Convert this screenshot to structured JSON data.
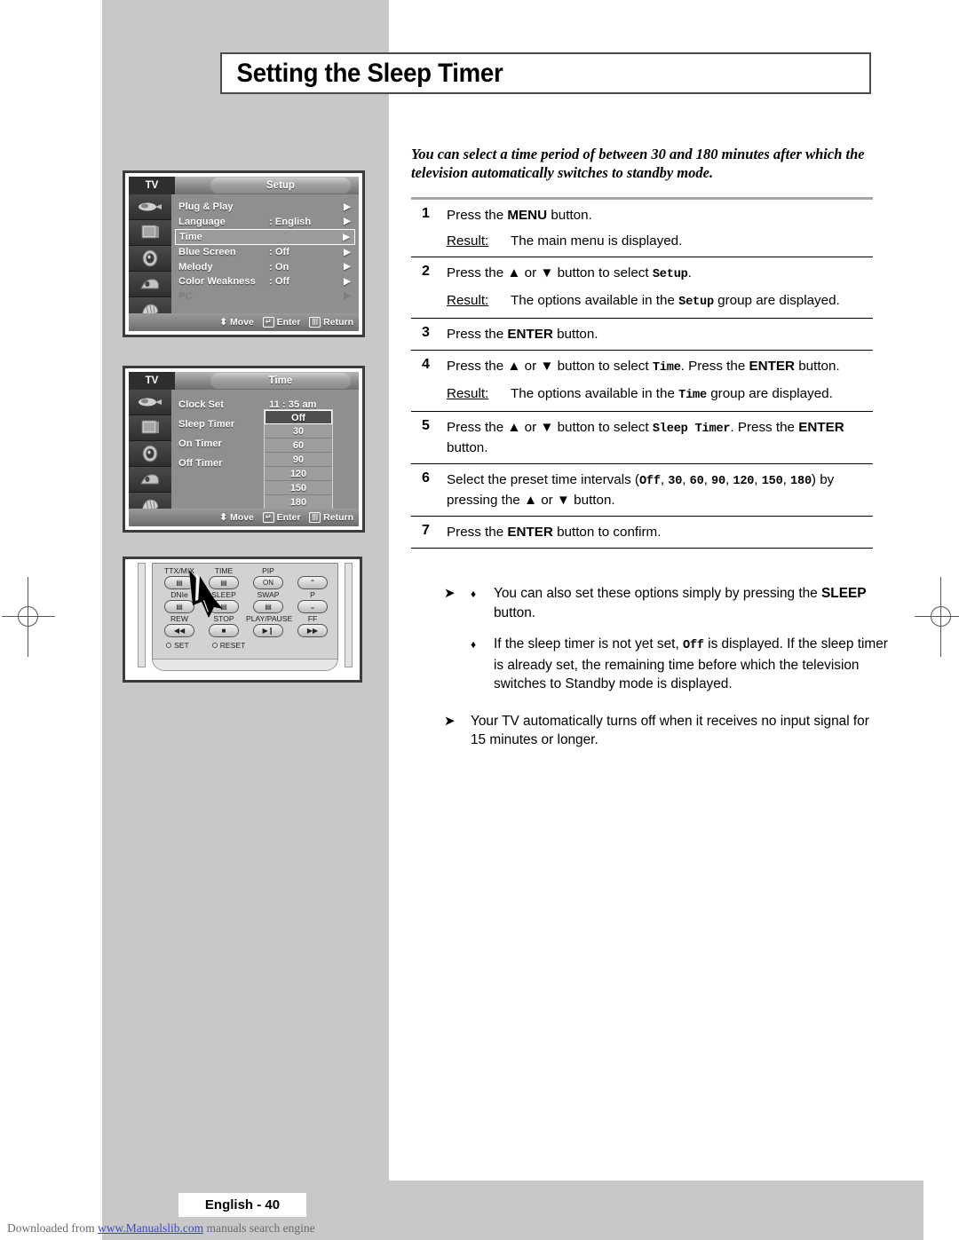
{
  "page": {
    "title": "Setting the Sleep Timer",
    "intro": "You can select a time period of between 30 and 180 minutes after which the television automatically switches to standby mode.",
    "footer_page_label": "English - 40",
    "download_prefix": "Downloaded from ",
    "download_link": "www.Manualslib.com",
    "download_suffix": " manuals search engine"
  },
  "steps": [
    {
      "num": "1",
      "text_pre": "Press the ",
      "bold": "MENU",
      "text_post": " button.",
      "result_label": "Result:",
      "result_text": "The main menu is displayed."
    },
    {
      "num": "2",
      "text_pre": "Press the ▲ or ▼ button to select ",
      "mono": "Setup",
      "text_post": ".",
      "result_label": "Result:",
      "result_pre": "The options available in the ",
      "result_mono": "Setup",
      "result_post": " group are displayed."
    },
    {
      "num": "3",
      "text_pre": "Press the ",
      "bold": "ENTER",
      "text_post": " button."
    },
    {
      "num": "4",
      "text_pre": "Press the ▲ or ▼ button to select ",
      "mono": "Time",
      "text_mid": ". Press the ",
      "bold": "ENTER",
      "text_post": " button.",
      "result_label": "Result:",
      "result_pre": "The options available in the ",
      "result_mono": "Time",
      "result_post": " group are displayed."
    },
    {
      "num": "5",
      "text_pre": "Press the ▲ or ▼ button to select ",
      "mono": "Sleep Timer",
      "text_mid": ". Press the ",
      "bold": "ENTER",
      "text_post": " button."
    },
    {
      "num": "6",
      "text_pre": "Select the preset time intervals (",
      "mono_list": [
        "Off",
        "30",
        "60",
        "90",
        "120",
        "150",
        "180"
      ],
      "text_post": ") by pressing the ▲ or ▼ button."
    },
    {
      "num": "7",
      "text_pre": "Press the ",
      "bold": "ENTER",
      "text_post": " button to confirm."
    }
  ],
  "notes": [
    {
      "marker": "➤",
      "bullets": [
        {
          "diamond": "♦",
          "pre": "You can also set these options simply by pressing the ",
          "bold": "SLEEP",
          "post": " button."
        },
        {
          "diamond": "♦",
          "pre": "If the sleep timer is not yet set, ",
          "mono": "Off",
          "post": " is displayed. If the sleep timer is already set, the remaining time before which the television switches to Standby mode is displayed."
        }
      ]
    },
    {
      "marker": "➤",
      "plain": "Your TV automatically turns off when it receives no input signal for 15 minutes or longer."
    }
  ],
  "osd_setup": {
    "tv_label": "TV",
    "title": "Setup",
    "rows": [
      {
        "label": "Plug & Play",
        "value": "",
        "arrow": "▶",
        "selected": false,
        "dim": false
      },
      {
        "label": "Language",
        "value": ": English",
        "arrow": "▶",
        "selected": false,
        "dim": false
      },
      {
        "label": "Time",
        "value": "",
        "arrow": "▶",
        "selected": true,
        "dim": false
      },
      {
        "label": "Blue Screen",
        "value": ": Off",
        "arrow": "▶",
        "selected": false,
        "dim": false
      },
      {
        "label": "Melody",
        "value": ": On",
        "arrow": "▶",
        "selected": false,
        "dim": false
      },
      {
        "label": "Color Weakness",
        "value": ": Off",
        "arrow": "▶",
        "selected": false,
        "dim": false
      },
      {
        "label": "PC",
        "value": "",
        "arrow": "▶",
        "selected": false,
        "dim": true
      }
    ],
    "footer": {
      "move": "Move",
      "enter": "Enter",
      "return": "Return"
    }
  },
  "osd_time": {
    "tv_label": "TV",
    "title": "Time",
    "rows": [
      {
        "label": "Clock Set",
        "value": "11 : 35  am"
      },
      {
        "label": "Sleep Timer",
        "value": ":"
      },
      {
        "label": "On Timer",
        "value": ""
      },
      {
        "label": "Off Timer",
        "value": ""
      }
    ],
    "dropdown": {
      "options": [
        "Off",
        "30",
        "60",
        "90",
        "120",
        "150",
        "180"
      ],
      "selected": "Off"
    },
    "footer": {
      "move": "Move",
      "enter": "Enter",
      "return": "Return"
    }
  },
  "remote": {
    "rows": [
      [
        {
          "label": "TTX/MIX",
          "glyph": "▤"
        },
        {
          "label": "TIME",
          "glyph": "▤"
        },
        {
          "label": "PIP",
          "glyph": "ON"
        },
        {
          "label": "",
          "glyph": "⌃"
        }
      ],
      [
        {
          "label": "DNIe",
          "glyph": "▤"
        },
        {
          "label": "SLEEP",
          "glyph": "▤"
        },
        {
          "label": "SWAP",
          "glyph": "▤"
        },
        {
          "label": "P",
          "glyph": "⌄"
        }
      ],
      [
        {
          "label": "REW",
          "glyph": "◀◀"
        },
        {
          "label": "STOP",
          "glyph": "■"
        },
        {
          "label": "PLAY/PAUSE",
          "glyph": "▶❙"
        },
        {
          "label": "FF",
          "glyph": "▶▶"
        }
      ]
    ],
    "set_label": "SET",
    "reset_label": "RESET"
  }
}
